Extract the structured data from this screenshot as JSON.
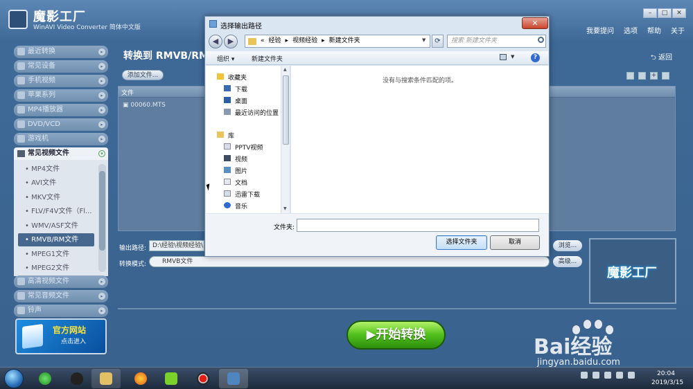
{
  "app": {
    "title": "魔影工厂",
    "subtitle": "WinAVI Video Converter 简体中文版",
    "menu": [
      "我要提问",
      "选项",
      "帮助",
      "关于"
    ],
    "window_controls": [
      "–",
      "□",
      "✕"
    ]
  },
  "sidebar": {
    "categories_top": [
      "最近转换",
      "常见设备",
      "手机视频",
      "苹果系列",
      "MP4播放器",
      "DVD/VCD",
      "游戏机"
    ],
    "open_category": "常见视频文件",
    "subitems": [
      "MP4文件",
      "AVI文件",
      "MKV文件",
      "FLV/F4V文件（Fl...",
      "WMV/ASF文件",
      "RMVB/RM文件",
      "MPEG1文件",
      "MPEG2文件"
    ],
    "selected_subitem": "RMVB/RM文件",
    "categories_bottom": [
      "高清视频文件",
      "常见音频文件",
      "铃声"
    ],
    "banner": {
      "title": "官方网站",
      "subtitle": "点击进入"
    }
  },
  "main": {
    "title": "转换到 RMVB/RM",
    "back": "返回",
    "add_file": "添加文件...",
    "file_column": "文件",
    "files": [
      "00060.MTS"
    ],
    "output_label": "输出路径:",
    "output_path": "D:\\经验\\视频经验\\",
    "browse": "浏览...",
    "mode_label": "转换模式:",
    "mode_value": "RMVB文件",
    "advanced": "高级...",
    "brand_logo": "魔影工厂",
    "start": "开始转换"
  },
  "dialog": {
    "title": "选择输出路径",
    "close": "✕",
    "address": {
      "prefix": "«",
      "parts": [
        "经验",
        "视频经验",
        "新建文件夹"
      ],
      "sep": "▸"
    },
    "search_placeholder": "搜索 新建文件夹",
    "toolbar": {
      "organize": "组织 ▾",
      "new_folder": "新建文件夹",
      "help": "?"
    },
    "tree": {
      "favorites": "收藏夹",
      "favorites_items": [
        "下载",
        "桌面",
        "最近访问的位置"
      ],
      "libraries": "库",
      "library_items": [
        "PPTV视频",
        "视频",
        "图片",
        "文档",
        "迅雷下载",
        "音乐"
      ]
    },
    "empty_message": "没有与搜索条件匹配的项。",
    "folder_label": "文件夹:",
    "folder_value": "",
    "select_button": "选择文件夹",
    "cancel_button": "取消"
  },
  "taskbar": {
    "time": "20:04",
    "date": "2019/3/15"
  },
  "watermark": {
    "text": "Bai经验",
    "url": "jingyan.baidu.com"
  },
  "colors": {
    "app_bg": "#3f6a98",
    "start_button": "#4fbf1b",
    "dialog_bg": "#dbe6f3",
    "close_button": "#c8442d"
  }
}
